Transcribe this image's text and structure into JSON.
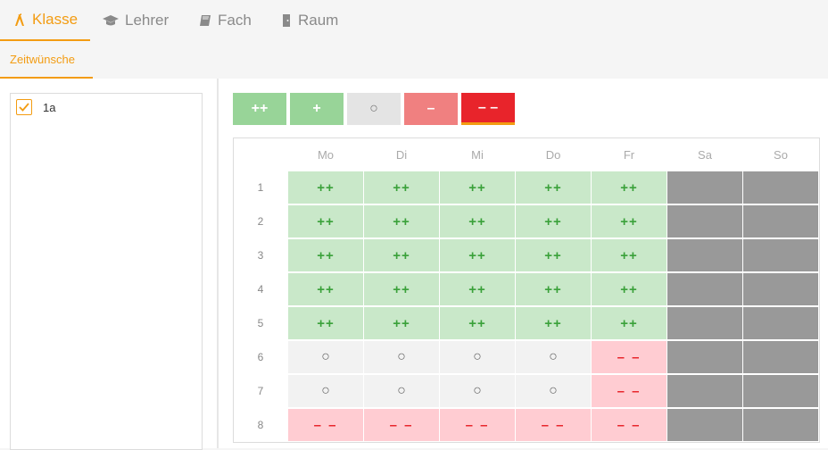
{
  "tabs": [
    {
      "label": "Klasse",
      "icon": "class-icon",
      "active": true
    },
    {
      "label": "Lehrer",
      "icon": "graduation-cap-icon",
      "active": false
    },
    {
      "label": "Fach",
      "icon": "book-icon",
      "active": false
    },
    {
      "label": "Raum",
      "icon": "door-icon",
      "active": false
    }
  ],
  "subtab": {
    "label": "Zeitwünsche"
  },
  "classes": [
    {
      "label": "1a",
      "checked": true
    }
  ],
  "legend": [
    {
      "symbol": "++",
      "kind": "pp"
    },
    {
      "symbol": "+",
      "kind": "p"
    },
    {
      "symbol": "○",
      "kind": "o"
    },
    {
      "symbol": "–",
      "kind": "m"
    },
    {
      "symbol": "– –",
      "kind": "mm",
      "selected": true
    }
  ],
  "days": [
    "Mo",
    "Di",
    "Mi",
    "Do",
    "Fr",
    "Sa",
    "So"
  ],
  "periods": [
    "1",
    "2",
    "3",
    "4",
    "5",
    "6",
    "7",
    "8"
  ],
  "symbols": {
    "pp": "++",
    "o": "○",
    "mm": "– –",
    "x": ""
  },
  "grid": [
    [
      "pp",
      "pp",
      "pp",
      "pp",
      "pp",
      "x",
      "x"
    ],
    [
      "pp",
      "pp",
      "pp",
      "pp",
      "pp",
      "x",
      "x"
    ],
    [
      "pp",
      "pp",
      "pp",
      "pp",
      "pp",
      "x",
      "x"
    ],
    [
      "pp",
      "pp",
      "pp",
      "pp",
      "pp",
      "x",
      "x"
    ],
    [
      "pp",
      "pp",
      "pp",
      "pp",
      "pp",
      "x",
      "x"
    ],
    [
      "o",
      "o",
      "o",
      "o",
      "mm",
      "x",
      "x"
    ],
    [
      "o",
      "o",
      "o",
      "o",
      "mm",
      "x",
      "x"
    ],
    [
      "mm",
      "mm",
      "mm",
      "mm",
      "mm",
      "x",
      "x"
    ]
  ],
  "colors": {
    "accent": "#f39c12",
    "positive": "#3aa13a",
    "negative": "#e8242b",
    "blocked": "#999999"
  }
}
